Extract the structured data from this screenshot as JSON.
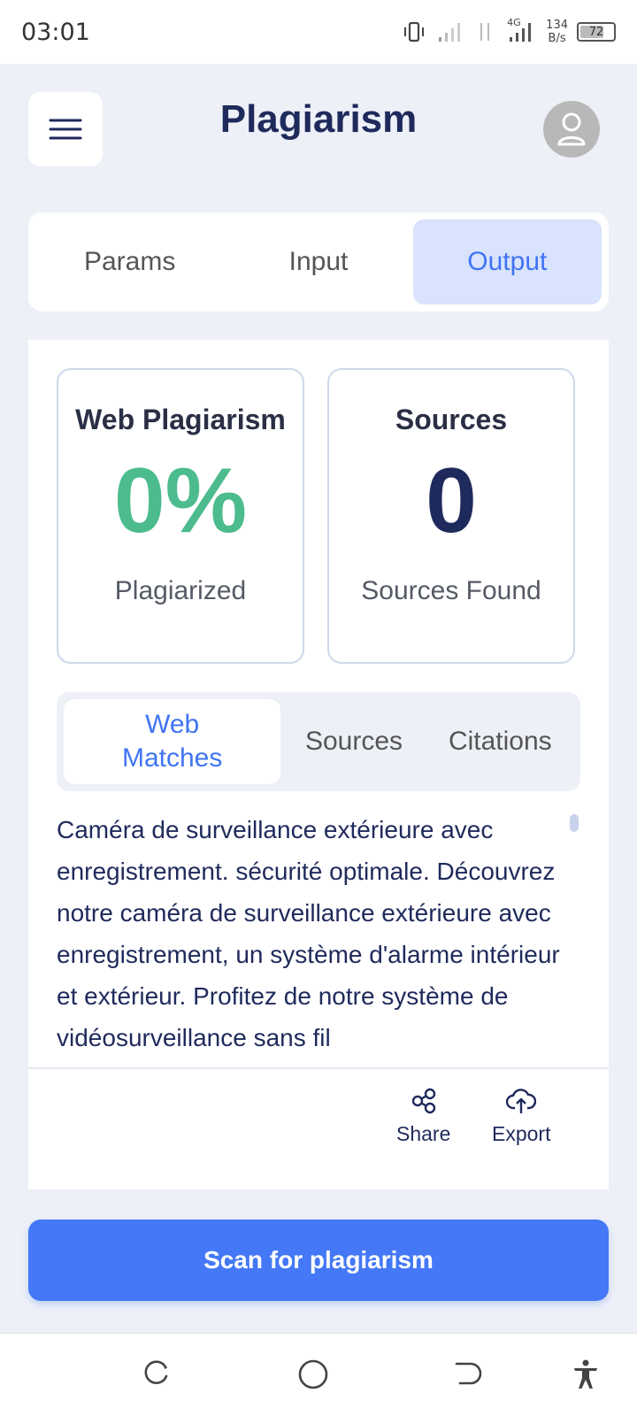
{
  "status": {
    "time": "03:01",
    "net_speed_value": "134",
    "net_speed_unit": "B/s",
    "network": "4G",
    "battery": "72"
  },
  "header": {
    "title": "Plagiarism",
    "menu_icon": "hamburger-icon",
    "avatar_icon": "user-icon"
  },
  "tabs": [
    {
      "label": "Params",
      "active": false
    },
    {
      "label": "Input",
      "active": false
    },
    {
      "label": "Output",
      "active": true
    }
  ],
  "stats": {
    "web": {
      "title": "Web Plagiarism",
      "value": "0%",
      "caption": "Plagiarized",
      "color": "#4cbb8d"
    },
    "sources": {
      "title": "Sources",
      "value": "0",
      "caption": "Sources Found",
      "color": "#1f2a5c"
    }
  },
  "subtabs": [
    {
      "label": "Web Matches",
      "active": true
    },
    {
      "label": "Sources",
      "active": false
    },
    {
      "label": "Citations",
      "active": false
    }
  ],
  "output_text": "Caméra de surveillance extérieure avec enregistrement. sécurité optimale. Découvrez notre caméra de surveillance extérieure avec enregistrement, un système d'alarme intérieur et extérieur. Profitez de notre système de vidéosurveillance sans fil",
  "actions": {
    "share": "Share",
    "export": "Export"
  },
  "scan_button": "Scan for plagiarism",
  "colors": {
    "accent": "#4478f6",
    "active_tab_bg": "#d9e3fc",
    "navy": "#1f2a5c",
    "green": "#4cbb8d"
  }
}
